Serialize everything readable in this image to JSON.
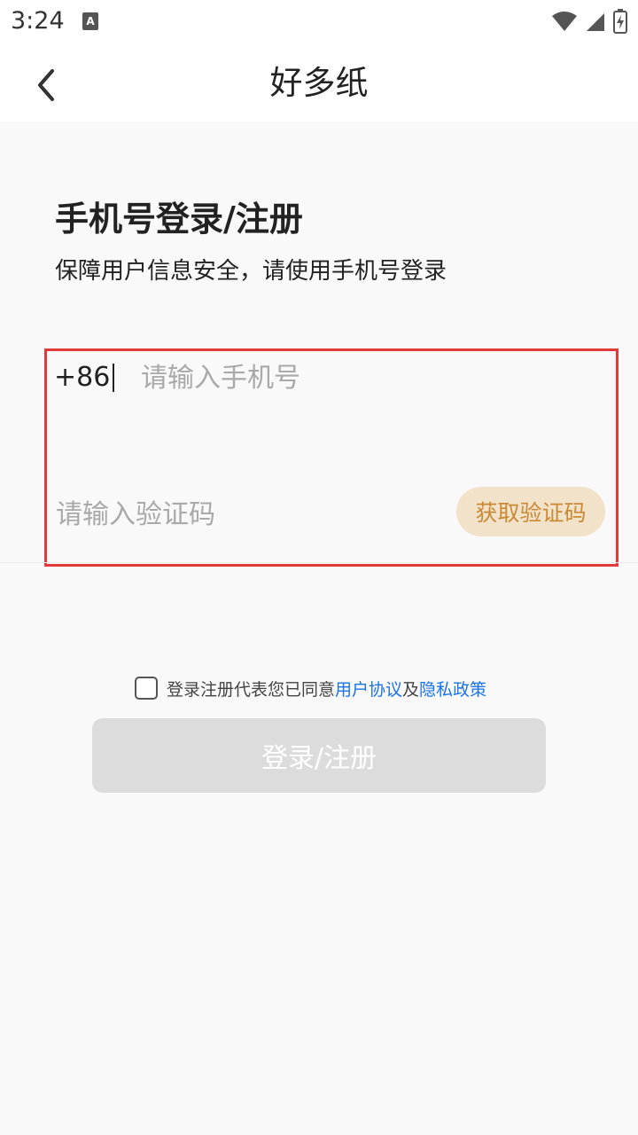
{
  "status_bar": {
    "time": "3:24",
    "notification_icon": "a-icon",
    "wifi_icon": "wifi-icon",
    "signal_icon": "signal-icon",
    "battery_icon": "battery-charging-icon"
  },
  "app_bar": {
    "back_icon": "chevron-left-icon",
    "title": "好多纸"
  },
  "header": {
    "title": "手机号登录/注册",
    "subtitle": "保障用户信息安全，请使用手机号登录"
  },
  "form": {
    "country_code": "+86",
    "phone_placeholder": "请输入手机号",
    "phone_value": "",
    "code_placeholder": "请输入验证码",
    "code_value": "",
    "get_code_label": "获取验证码"
  },
  "agreement": {
    "checked": false,
    "prefix": "登录注册代表您已同意",
    "user_agreement": "用户协议",
    "conjunction": "及",
    "privacy_policy": "隐私政策"
  },
  "submit": {
    "label": "登录/注册"
  },
  "colors": {
    "accent": "#c98a35",
    "accent_bg": "#f2e2c9",
    "link": "#1a73e8",
    "highlight_border": "#e03a3a",
    "disabled_button": "#dcdcdc"
  }
}
